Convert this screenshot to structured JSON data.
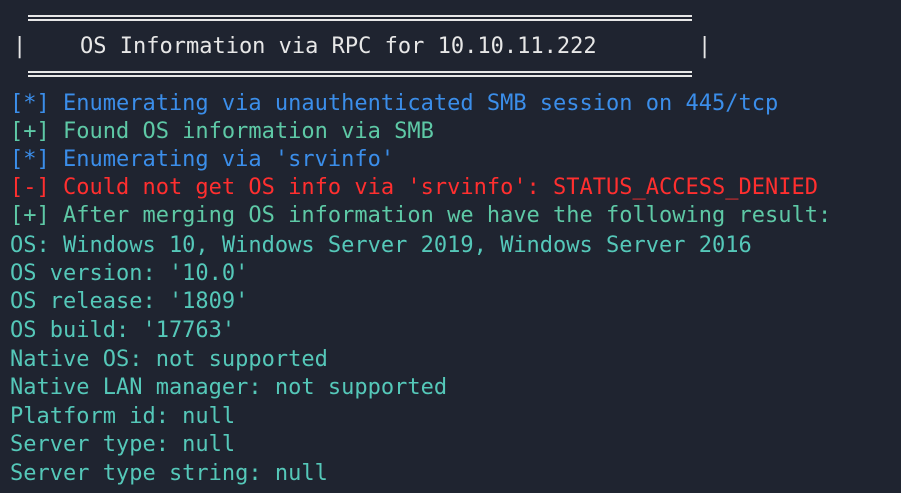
{
  "banner": {
    "left_pipe": "|",
    "title": "OS Information via RPC for 10.10.11.222",
    "right_pipe": "|"
  },
  "output": {
    "lines": [
      {
        "text": "[*] Enumerating via unauthenticated SMB session on 445/tcp",
        "color": "#3b8eea"
      },
      {
        "text": "[+] Found OS information via SMB",
        "color": "#5ec9a6"
      },
      {
        "text": "[*] Enumerating via 'srvinfo'",
        "color": "#3b8eea"
      },
      {
        "text": "[-] Could not get OS info via 'srvinfo': STATUS_ACCESS_DENIED",
        "color": "#ff2f2f"
      },
      {
        "text": "[+] After merging OS information we have the following result:",
        "color": "#5ec9a6"
      },
      {
        "text": "OS: Windows 10, Windows Server 2019, Windows Server 2016",
        "color": "#55c8b9"
      },
      {
        "text": "OS version: '10.0'",
        "color": "#55c8b9"
      },
      {
        "text": "OS release: '1809'",
        "color": "#55c8b9"
      },
      {
        "text": "OS build: '17763'",
        "color": "#55c8b9"
      },
      {
        "text": "Native OS: not supported",
        "color": "#55c8b9"
      },
      {
        "text": "Native LAN manager: not supported",
        "color": "#55c8b9"
      },
      {
        "text": "Platform id: null",
        "color": "#55c8b9"
      },
      {
        "text": "Server type: null",
        "color": "#55c8b9"
      },
      {
        "text": "Server type string: null",
        "color": "#55c8b9"
      }
    ]
  }
}
